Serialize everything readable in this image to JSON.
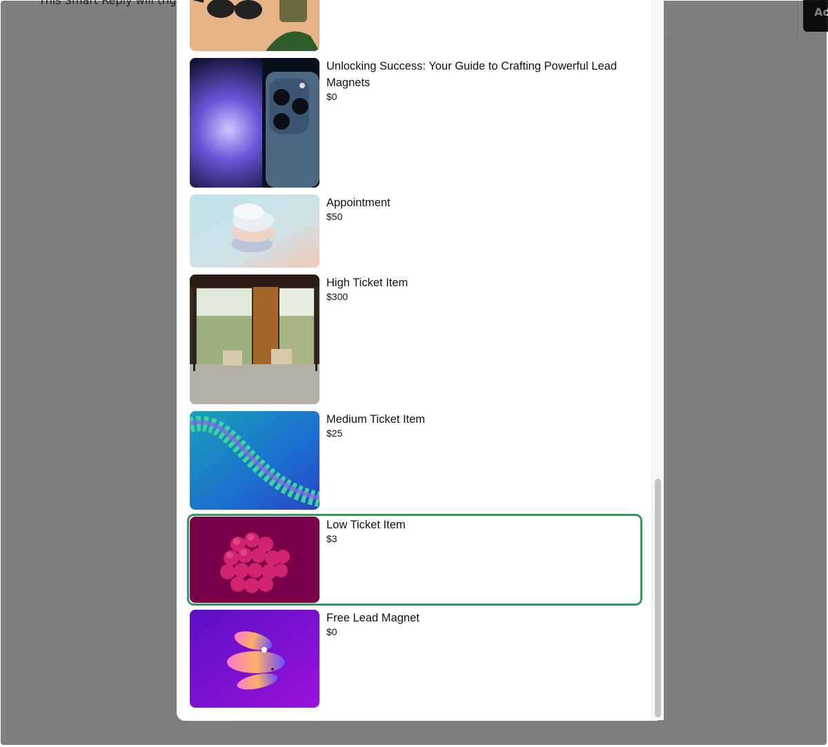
{
  "background": {
    "partial_text": "This Smart Reply will trigg",
    "partial_button": "Ad"
  },
  "products": [
    {
      "title": "",
      "price": ""
    },
    {
      "title": "Unlocking Success: Your Guide to Crafting Powerful Lead Magnets",
      "price": "$0"
    },
    {
      "title": "Appointment",
      "price": "$50"
    },
    {
      "title": "High Ticket Item",
      "price": "$300"
    },
    {
      "title": "Medium Ticket Item",
      "price": "$25"
    },
    {
      "title": "Low Ticket Item",
      "price": "$3"
    },
    {
      "title": "Free Lead Magnet",
      "price": "$0"
    }
  ],
  "selected_index": 5,
  "colors": {
    "selection_border": "#2e9d5c",
    "overlay": "rgba(0,0,0,0.5)"
  }
}
